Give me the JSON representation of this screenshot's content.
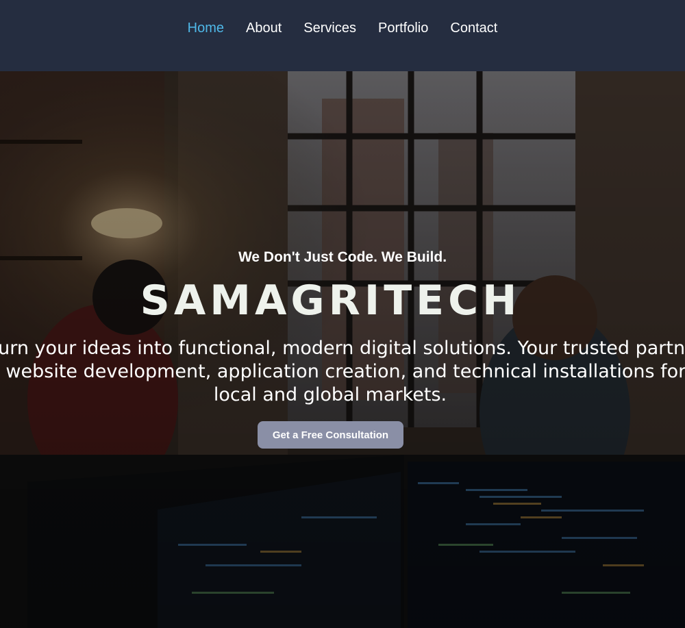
{
  "nav": {
    "items": [
      {
        "label": "Home",
        "active": true
      },
      {
        "label": "About",
        "active": false
      },
      {
        "label": "Services",
        "active": false
      },
      {
        "label": "Portfolio",
        "active": false
      },
      {
        "label": "Contact",
        "active": false
      }
    ],
    "active_color": "#4fb8e8",
    "background_color": "#252d40"
  },
  "hero": {
    "tagline": "We Don't Just Code. We Build.",
    "brand": "SAMAGRITECH",
    "description": "We turn your ideas into functional, modern digital solutions. Your trusted partner for website development, application creation, and technical installations for local and global markets.",
    "cta_label": "Get a Free Consultation",
    "cta_color": "#8a8fa6",
    "background_image": "dark office with developers at multiple code monitors"
  }
}
